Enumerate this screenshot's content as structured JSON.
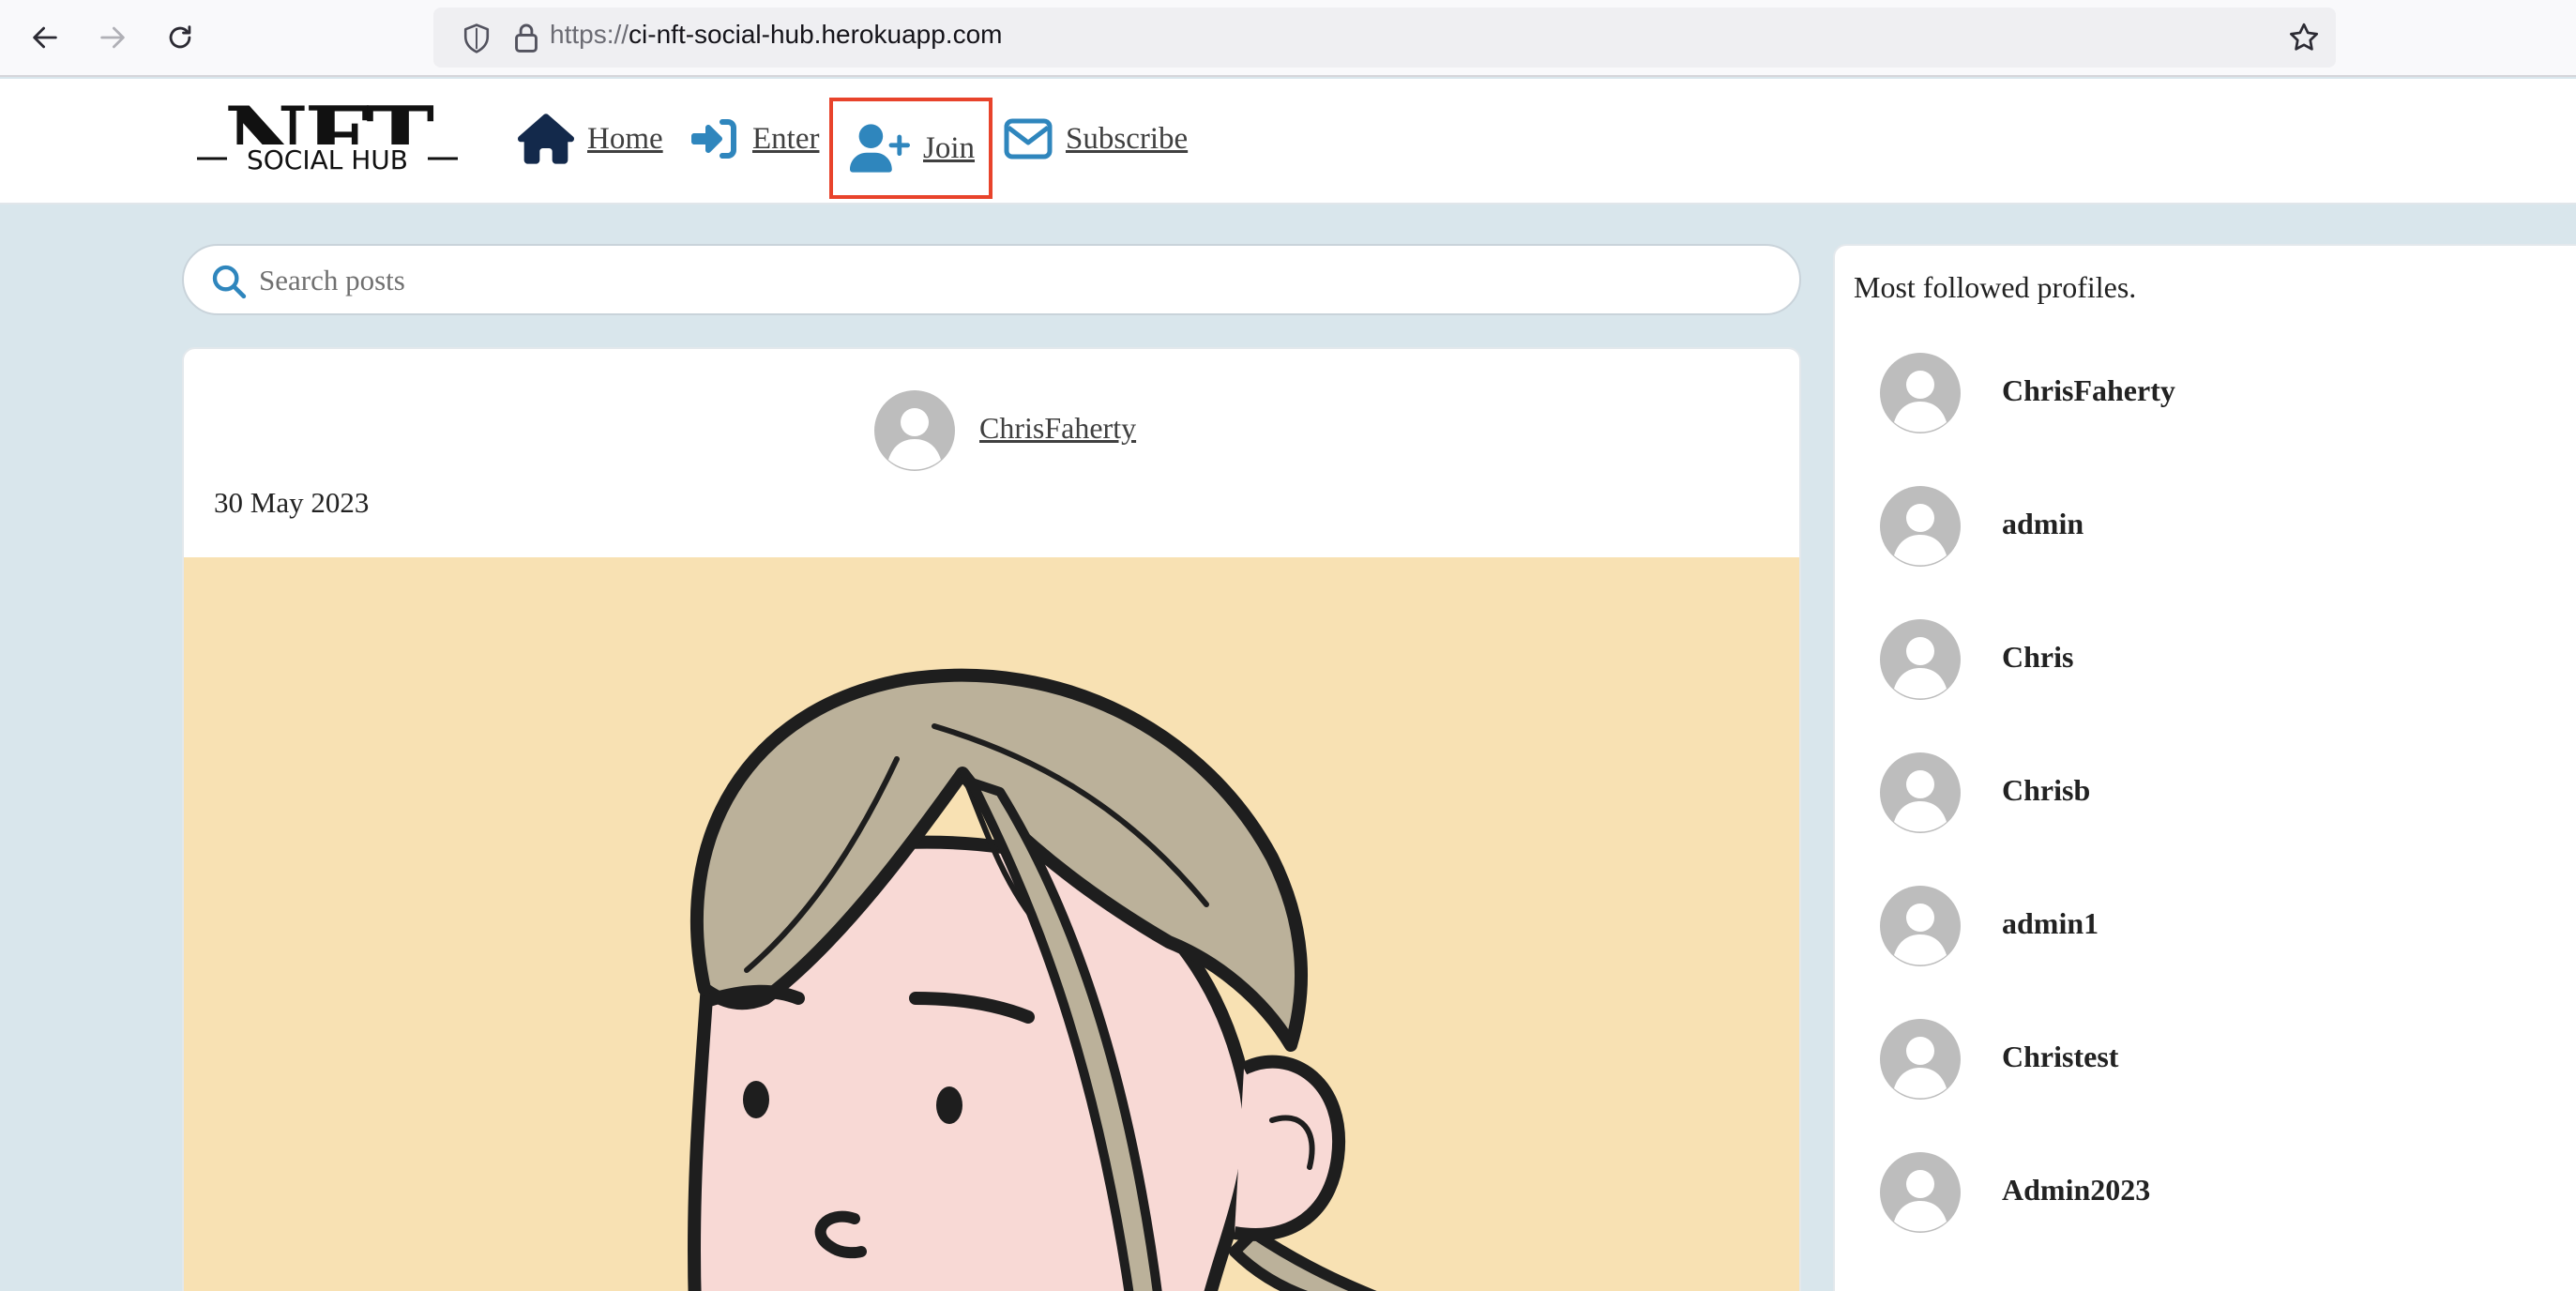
{
  "browser": {
    "url_scheme": "https://",
    "url_host": "ci-nft-social-hub.herokuapp.com"
  },
  "navbar": {
    "logo_text": "NFT",
    "logo_subtext": "SOCIAL HUB",
    "items": [
      {
        "label": "Home",
        "icon": "home-icon"
      },
      {
        "label": "Enter",
        "icon": "sign-in-icon"
      },
      {
        "label": "Join",
        "icon": "user-plus-icon",
        "highlighted": true
      },
      {
        "label": "Subscribe",
        "icon": "envelope-icon"
      }
    ],
    "highlight_color": "#e8432b",
    "icon_color": "#2f86bd",
    "home_icon_color": "#13294b"
  },
  "search": {
    "placeholder": "Search posts",
    "value": ""
  },
  "post": {
    "author": "ChrisFaherty",
    "date": "30 May 2023",
    "image_background": "#f8e1b3"
  },
  "sidebar": {
    "title": "Most followed profiles.",
    "profiles": [
      {
        "name": "ChrisFaherty"
      },
      {
        "name": "admin"
      },
      {
        "name": "Chris"
      },
      {
        "name": "Chrisb"
      },
      {
        "name": "admin1"
      },
      {
        "name": "Christest"
      },
      {
        "name": "Admin2023"
      }
    ]
  }
}
